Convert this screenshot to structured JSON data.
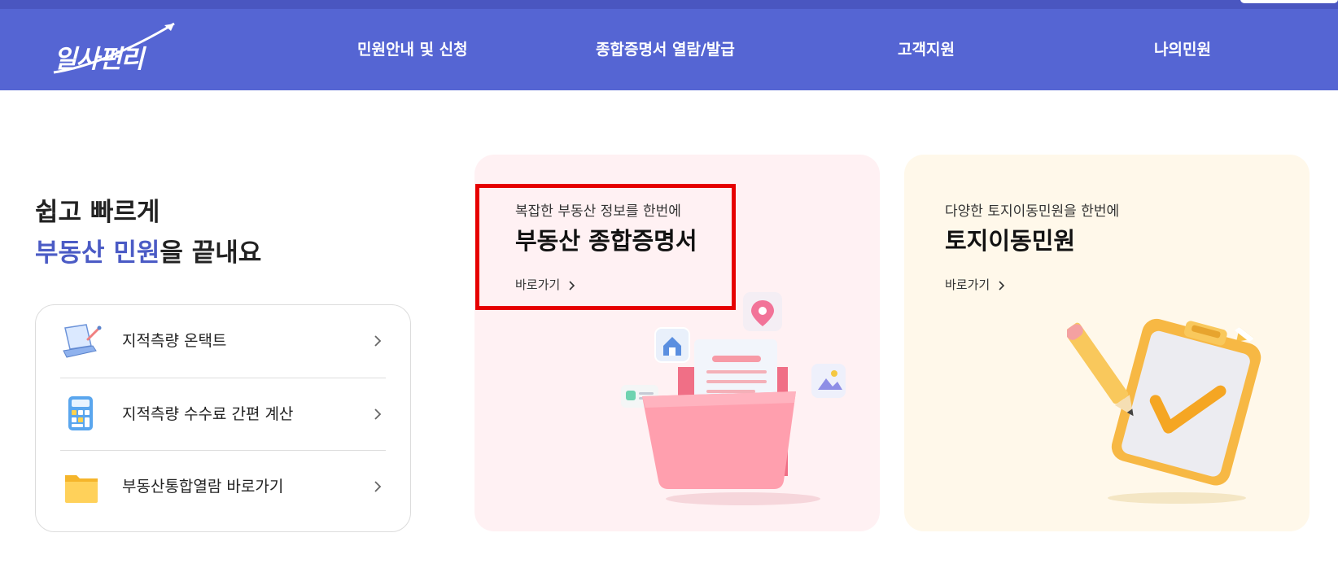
{
  "header": {
    "logo_text": "일사편리",
    "nav": [
      {
        "label": "민원안내 및 신청"
      },
      {
        "label": "종합증명서 열람/발급"
      },
      {
        "label": "고객지원"
      },
      {
        "label": "나의민원"
      }
    ]
  },
  "hero": {
    "line1": "쉽고 빠르게",
    "line2_accent": "부동산 민원",
    "line2_rest": "을 끝내요"
  },
  "quick_links": [
    {
      "label": "지적측량 온택트",
      "icon": "laptop-pen-icon"
    },
    {
      "label": "지적측량 수수료 간편 계산",
      "icon": "calculator-icon"
    },
    {
      "label": "부동산통합열람 바로가기",
      "icon": "folder-icon"
    }
  ],
  "cards": [
    {
      "subtitle": "복잡한 부동산 정보를 한번에",
      "title": "부동산 종합증명서",
      "link_label": "바로가기",
      "icon": "pink-folder-document-icon",
      "background": "#fff1f3"
    },
    {
      "subtitle": "다양한 토지이동민원을 한번에",
      "title": "토지이동민원",
      "link_label": "바로가기",
      "icon": "clipboard-check-pencil-icon",
      "background": "#fff8ea"
    }
  ],
  "colors": {
    "header_bg": "#5565d3",
    "accent": "#4b5bc5",
    "highlight": "#e60000"
  }
}
